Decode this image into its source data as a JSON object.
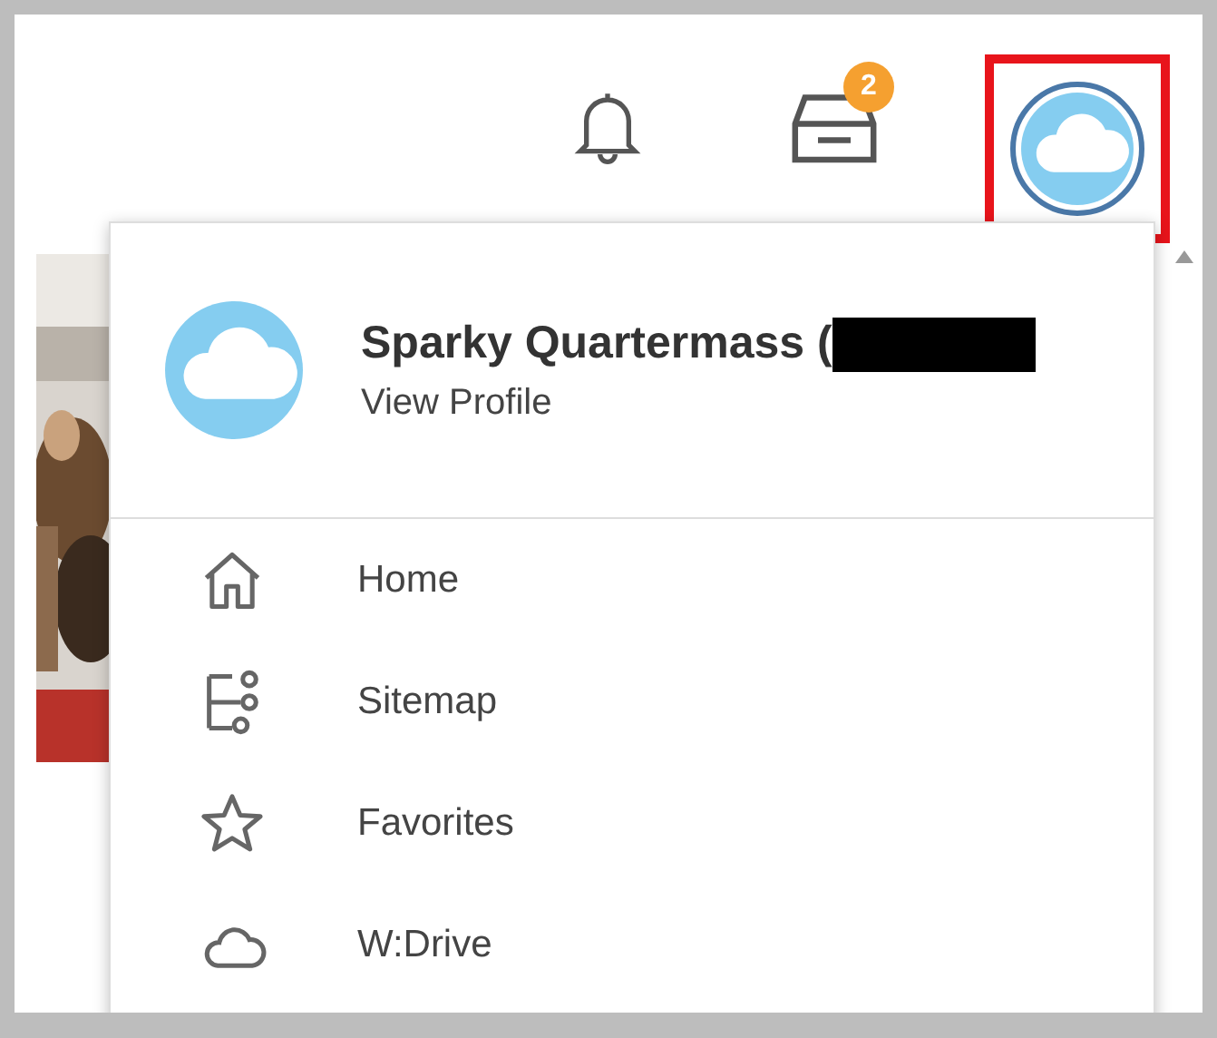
{
  "topbar": {
    "inbox_badge": "2"
  },
  "profile_menu": {
    "name": "Sparky Quartermass (",
    "link": "View Profile",
    "items": [
      {
        "label": "Home"
      },
      {
        "label": "Sitemap"
      },
      {
        "label": "Favorites"
      },
      {
        "label": "W:Drive"
      }
    ]
  }
}
